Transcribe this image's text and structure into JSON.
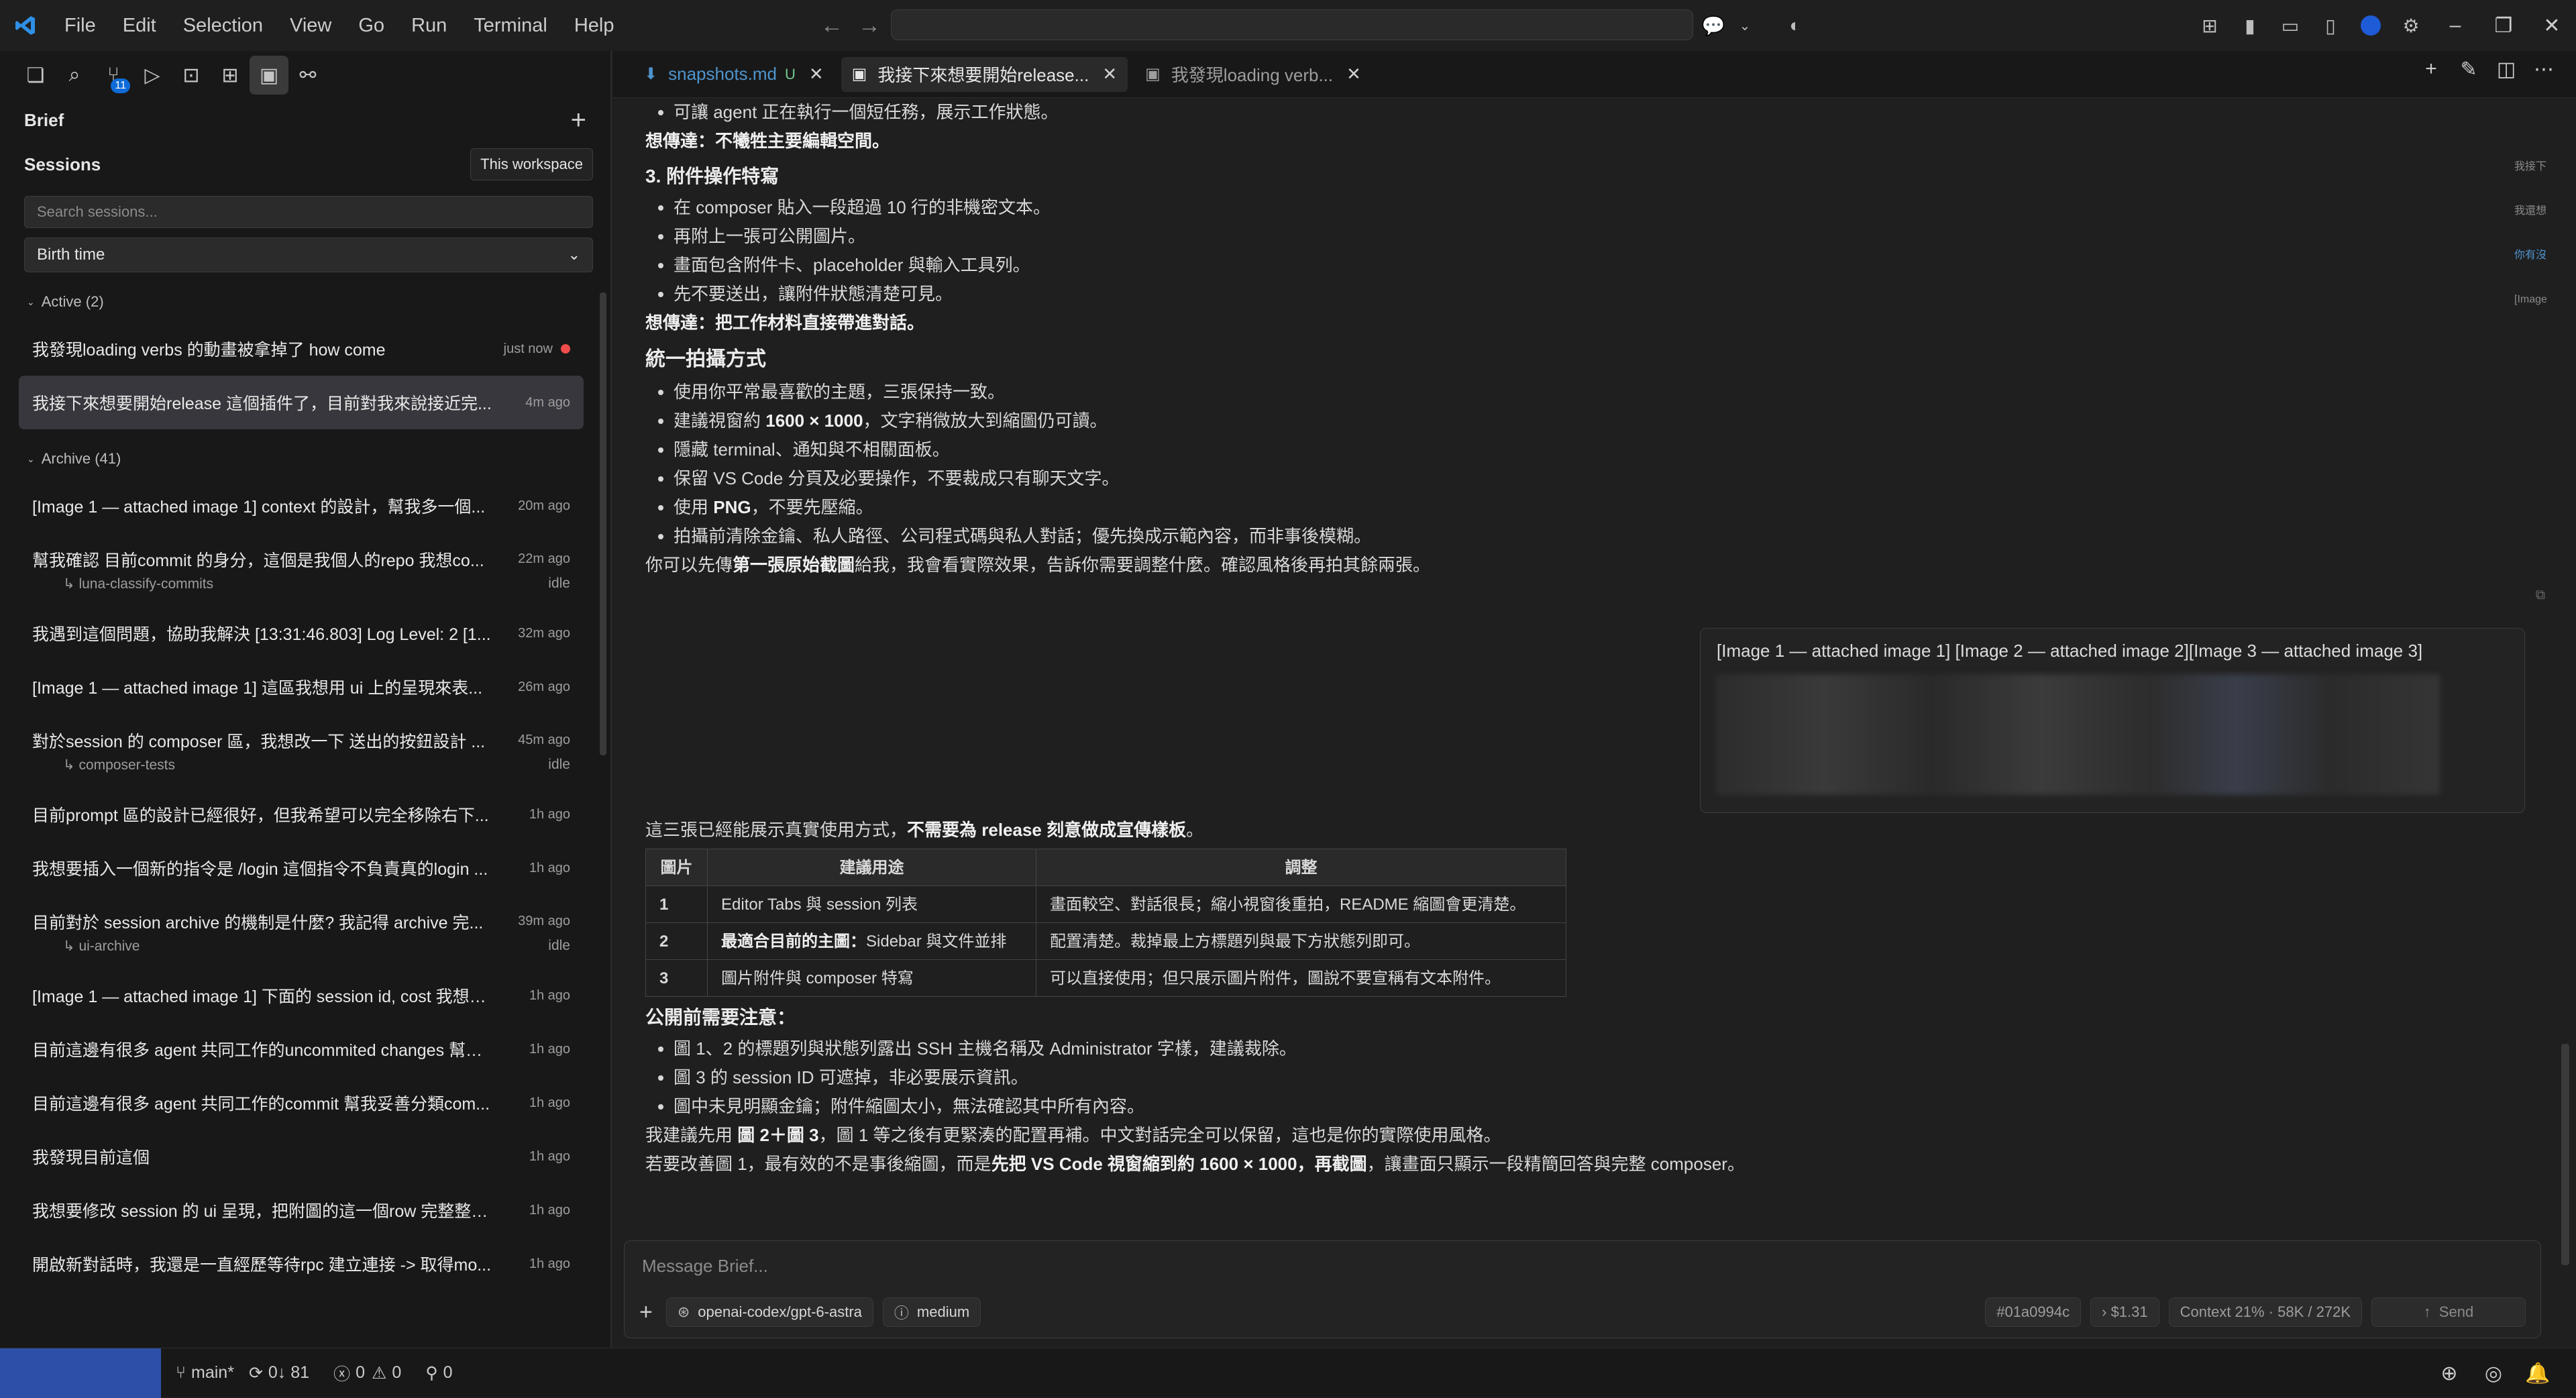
{
  "menu": [
    "File",
    "Edit",
    "Selection",
    "View",
    "Go",
    "Run",
    "Terminal",
    "Help"
  ],
  "sidebar": {
    "header": "Brief",
    "sessions_label": "Sessions",
    "workspace_button": "This workspace",
    "search_placeholder": "Search sessions...",
    "sort_value": "Birth time",
    "badge_count": "11",
    "active_group": "Active (2)",
    "archive_group": "Archive (41)",
    "active": [
      {
        "title": "我發現loading verbs 的動畫被拿掉了 how come",
        "time": "just now"
      },
      {
        "title": "我接下來想要開始release 這個插件了，目前對我來說接近完...",
        "time": "4m ago"
      }
    ],
    "archive": [
      {
        "title": "[Image 1 — attached image 1] context 的設計，幫我多一個...",
        "time": "20m ago"
      },
      {
        "title": "幫我確認 目前commit 的身分，這個是我個人的repo 我想co...",
        "time": "22m ago",
        "sub": "luna-classify-commits",
        "status": "idle"
      },
      {
        "title": "我遇到這個問題，協助我解決 [13:31:46.803] Log Level: 2 [1...",
        "time": "32m ago"
      },
      {
        "title": "[Image 1 — attached image 1] 這區我想用 ui 上的呈現來表...",
        "time": "26m ago"
      },
      {
        "title": "對於session 的 composer 區，我想改一下 送出的按鈕設計 ...",
        "time": "45m ago",
        "sub": "composer-tests",
        "status": "idle"
      },
      {
        "title": "目前prompt 區的設計已經很好，但我希望可以完全移除右下...",
        "time": "1h ago"
      },
      {
        "title": "我想要插入一個新的指令是 /login 這個指令不負責真的login ...",
        "time": "1h ago"
      },
      {
        "title": "目前對於 session archive 的機制是什麼? 我記得 archive 完...",
        "time": "39m ago",
        "sub": "ui-archive",
        "status": "idle"
      },
      {
        "title": "[Image 1 — attached image 1] 下面的 session id, cost 我想要...",
        "time": "1h ago"
      },
      {
        "title": "目前這邊有很多 agent 共同工作的uncommited changes 幫我...",
        "time": "1h ago"
      },
      {
        "title": "目前這邊有很多 agent 共同工作的commit 幫我妥善分類com...",
        "time": "1h ago"
      },
      {
        "title": "我發現目前這個",
        "time": "1h ago"
      },
      {
        "title": "我想要修改 session 的 ui 呈現，把附圖的這一個row 完整整合...",
        "time": "1h ago"
      },
      {
        "title": "開啟新對話時，我還是一直經歷等待rpc 建立連接 -> 取得mo...",
        "time": "1h ago"
      }
    ]
  },
  "tabs": [
    {
      "label": "snapshots.md",
      "flag": "U"
    },
    {
      "label": "我接下來想要開始release..."
    },
    {
      "label": "我發現loading verb..."
    }
  ],
  "minimap": [
    "我接下",
    "我還想",
    "你有沒",
    "[Image"
  ],
  "content": {
    "b0": "可讓 agent 正在執行一個短任務，展示工作狀態。",
    "w0": "想傳達：不犧牲主要編輯空間。",
    "h3": "3. 附件操作特寫",
    "l3": [
      "在 composer 貼入一段超過 10 行的非機密文本。",
      "再附上一張可公開圖片。",
      "畫面包含附件卡、placeholder 與輸入工具列。",
      "先不要送出，讓附件狀態清楚可見。"
    ],
    "w3": "想傳達：把工作材料直接帶進對話。",
    "h_unify": "統一拍攝方式",
    "u1": "使用你平常最喜歡的主題，三張保持一致。",
    "u2_pre": "建議視窗約 ",
    "u2_bold": "1600 × 1000",
    "u2_post": "，文字稍微放大到縮圖仍可讀。",
    "u3": "隱藏 terminal、通知與不相關面板。",
    "u4": "保留 VS Code 分頁及必要操作，不要裁成只有聊天文字。",
    "u5_pre": "使用 ",
    "u5_bold": "PNG",
    "u5_post": "，不要先壓縮。",
    "u6": "拍攝前清除金鑰、私人路徑、公司程式碼與私人對話；優先換成示範內容，而非事後模糊。",
    "p_first_pre": "你可以先傳",
    "p_first_bold": "第一張原始截圖",
    "p_first_post": "給我，我會看實際效果，告訴你需要調整什麼。確認風格後再拍其餘兩張。",
    "user_msg": "[Image 1 — attached image 1] [Image 2 — attached image 2][Image 3 — attached image 3]",
    "reply_pre": "這三張已經能展示真實使用方式，",
    "reply_bold": "不需要為 release 刻意做成宣傳樣板",
    "reply_post": "。",
    "table": {
      "headers": [
        "圖片",
        "建議用途",
        "調整"
      ],
      "rows": [
        {
          "n": "1",
          "use": "Editor Tabs 與 session 列表",
          "adj": "畫面較空、對話很長；縮小視窗後重拍，README 縮圖會更清楚。"
        },
        {
          "n": "2",
          "use_bold": "最適合目前的主圖：",
          "use": "Sidebar 與文件並排",
          "adj": "配置清楚。裁掉最上方標題列與最下方狀態列即可。"
        },
        {
          "n": "3",
          "use": "圖片附件與 composer 特寫",
          "adj": "可以直接使用；但只展示圖片附件，圖說不要宣稱有文本附件。"
        }
      ]
    },
    "h_notes": "公開前需要注意：",
    "n1": "圖 1、2 的標題列與狀態列露出 SSH 主機名稱及 Administrator 字樣，建議裁除。",
    "n2": "圖 3 的 session ID 可遮掉，非必要展示資訊。",
    "n3": "圖中未見明顯金鑰；附件縮圖太小，無法確認其中所有內容。",
    "p_rec_pre": "我建議先用 ",
    "p_rec_bold": "圖 2＋圖 3",
    "p_rec_post": "，圖 1 等之後有更緊湊的配置再補。中文對話完全可以保留，這也是你的實際使用風格。",
    "p_imp_pre": "若要改善圖 1，最有效的不是事後縮圖，而是",
    "p_imp_bold": "先把 VS Code 視窗縮到約 1600 × 1000，再截圖",
    "p_imp_post": "，讓畫面只顯示一段精簡回答與完整 composer。"
  },
  "composer": {
    "placeholder": "Message Brief...",
    "model": "openai-codex/gpt-6-astra",
    "effort": "medium",
    "session_id": "#01a0994c",
    "cost": "$1.31",
    "context": "Context 21% · 58K / 272K",
    "send": "Send"
  },
  "status": {
    "branch": "main*",
    "sync": "0↓ 81",
    "errors": "0",
    "warnings": "0",
    "ports": "0"
  }
}
